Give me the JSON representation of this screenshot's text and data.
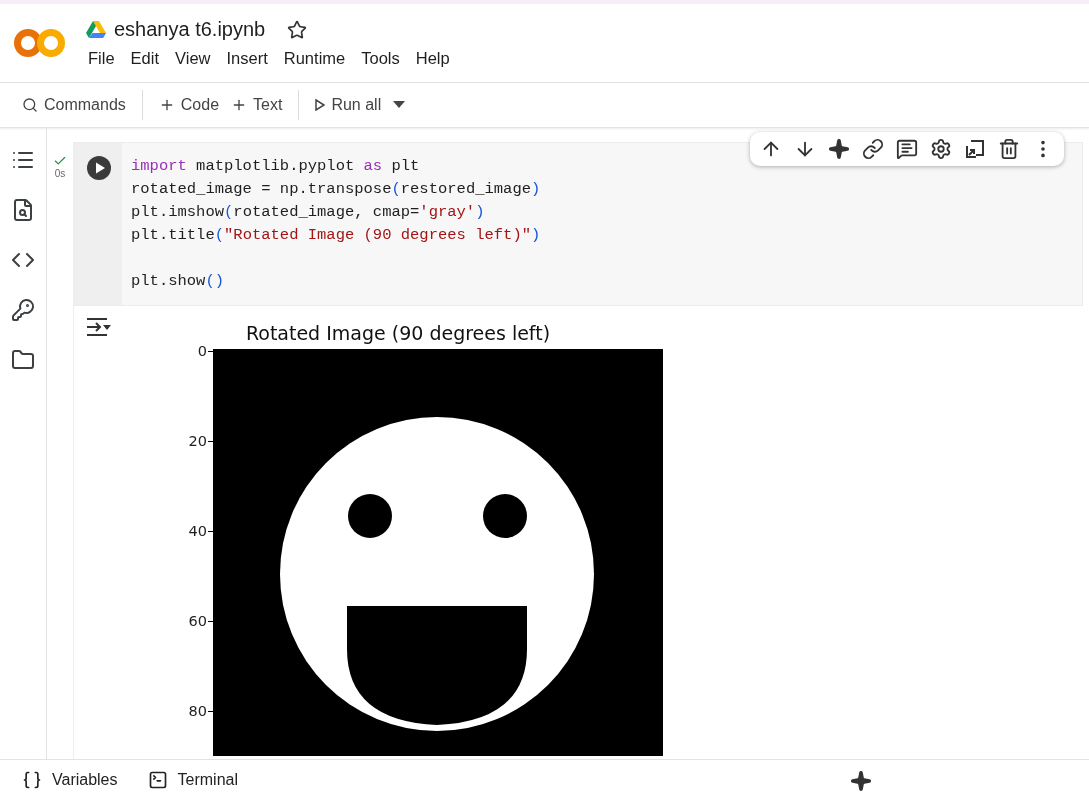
{
  "notebook": {
    "title": "eshanya t6.ipynb",
    "starred": false
  },
  "menu": [
    "File",
    "Edit",
    "View",
    "Insert",
    "Runtime",
    "Tools",
    "Help"
  ],
  "toolbar": {
    "search": "Commands",
    "add_buttons": [
      "Code",
      "Text"
    ],
    "run_all": "Run all"
  },
  "cell": {
    "executed": true,
    "duration": "0s",
    "lines": [
      {
        "kind": "code",
        "tokens": [
          {
            "kind": "keyword",
            "text": "import"
          },
          {
            "kind": "plain",
            "text": " matplotlib.pyplot "
          },
          {
            "kind": "keyword",
            "text": "as"
          },
          {
            "kind": "plain",
            "text": " plt"
          }
        ]
      },
      {
        "kind": "code",
        "tokens": [
          {
            "kind": "plain",
            "text": "rotated_image = np.transpose"
          },
          {
            "kind": "paren",
            "text": "("
          },
          {
            "kind": "plain",
            "text": "restored_image"
          },
          {
            "kind": "paren",
            "text": ")"
          }
        ]
      },
      {
        "kind": "code",
        "tokens": [
          {
            "kind": "plain",
            "text": "plt.imshow"
          },
          {
            "kind": "paren",
            "text": "("
          },
          {
            "kind": "plain",
            "text": "rotated_image, cmap="
          },
          {
            "kind": "string",
            "text": "'gray'"
          },
          {
            "kind": "paren",
            "text": ")"
          }
        ]
      },
      {
        "kind": "code",
        "tokens": [
          {
            "kind": "plain",
            "text": "plt.title"
          },
          {
            "kind": "paren",
            "text": "("
          },
          {
            "kind": "string",
            "text": "\"Rotated Image (90 degrees left)\""
          },
          {
            "kind": "paren",
            "text": ")"
          }
        ]
      },
      {
        "kind": "blank"
      },
      {
        "kind": "code",
        "tokens": [
          {
            "kind": "plain",
            "text": "plt.show"
          },
          {
            "kind": "paren",
            "text": "()"
          }
        ]
      }
    ]
  },
  "output": {
    "plot_title": "Rotated Image (90 degrees left)",
    "yticks": [
      "0",
      "20",
      "40",
      "60",
      "80"
    ]
  },
  "bottom_bar": [
    {
      "kind": "variables",
      "label": "Variables"
    },
    {
      "kind": "terminal",
      "label": "Terminal"
    }
  ]
}
